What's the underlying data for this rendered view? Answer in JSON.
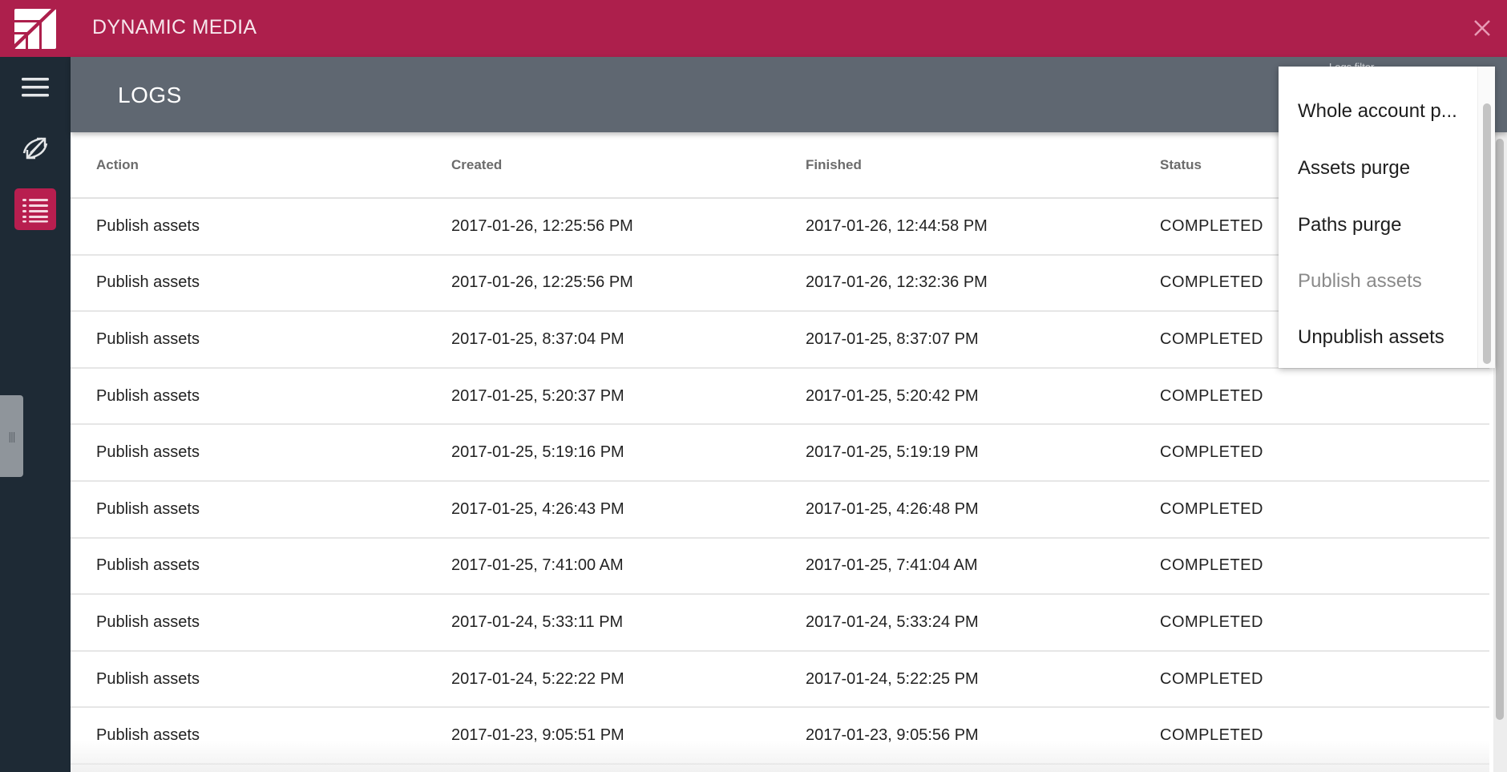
{
  "app": {
    "title": "DYNAMIC MEDIA",
    "brand_color": "#ad1f4c"
  },
  "page": {
    "title": "LOGS",
    "filter_label": "Logs filter"
  },
  "sidebar": {
    "items": [
      {
        "name": "menu",
        "icon": "hamburger-icon"
      },
      {
        "name": "sync",
        "icon": "sync-arrows-icon"
      },
      {
        "name": "logs",
        "icon": "list-icon",
        "active": true
      }
    ]
  },
  "table": {
    "columns": [
      "Action",
      "Created",
      "Finished",
      "Status"
    ],
    "rows": [
      {
        "action": "Publish assets",
        "created": "2017-01-26, 12:25:56 PM",
        "finished": "2017-01-26, 12:44:58 PM",
        "status": "COMPLETED"
      },
      {
        "action": "Publish assets",
        "created": "2017-01-26, 12:25:56 PM",
        "finished": "2017-01-26, 12:32:36 PM",
        "status": "COMPLETED"
      },
      {
        "action": "Publish assets",
        "created": "2017-01-25, 8:37:04 PM",
        "finished": "2017-01-25, 8:37:07 PM",
        "status": "COMPLETED"
      },
      {
        "action": "Publish assets",
        "created": "2017-01-25, 5:20:37 PM",
        "finished": "2017-01-25, 5:20:42 PM",
        "status": "COMPLETED"
      },
      {
        "action": "Publish assets",
        "created": "2017-01-25, 5:19:16 PM",
        "finished": "2017-01-25, 5:19:19 PM",
        "status": "COMPLETED"
      },
      {
        "action": "Publish assets",
        "created": "2017-01-25, 4:26:43 PM",
        "finished": "2017-01-25, 4:26:48 PM",
        "status": "COMPLETED"
      },
      {
        "action": "Publish assets",
        "created": "2017-01-25, 7:41:00 AM",
        "finished": "2017-01-25, 7:41:04 AM",
        "status": "COMPLETED"
      },
      {
        "action": "Publish assets",
        "created": "2017-01-24, 5:33:11 PM",
        "finished": "2017-01-24, 5:33:24 PM",
        "status": "COMPLETED"
      },
      {
        "action": "Publish assets",
        "created": "2017-01-24, 5:22:22 PM",
        "finished": "2017-01-24, 5:22:25 PM",
        "status": "COMPLETED"
      },
      {
        "action": "Publish assets",
        "created": "2017-01-23, 9:05:51 PM",
        "finished": "2017-01-23, 9:05:56 PM",
        "status": "COMPLETED"
      }
    ]
  },
  "filter_dropdown": {
    "options": [
      {
        "label": "Whole account p...",
        "disabled": false
      },
      {
        "label": "Assets purge",
        "disabled": false
      },
      {
        "label": "Paths purge",
        "disabled": false
      },
      {
        "label": "Publish assets",
        "disabled": true
      },
      {
        "label": "Unpublish assets",
        "disabled": false
      }
    ]
  }
}
